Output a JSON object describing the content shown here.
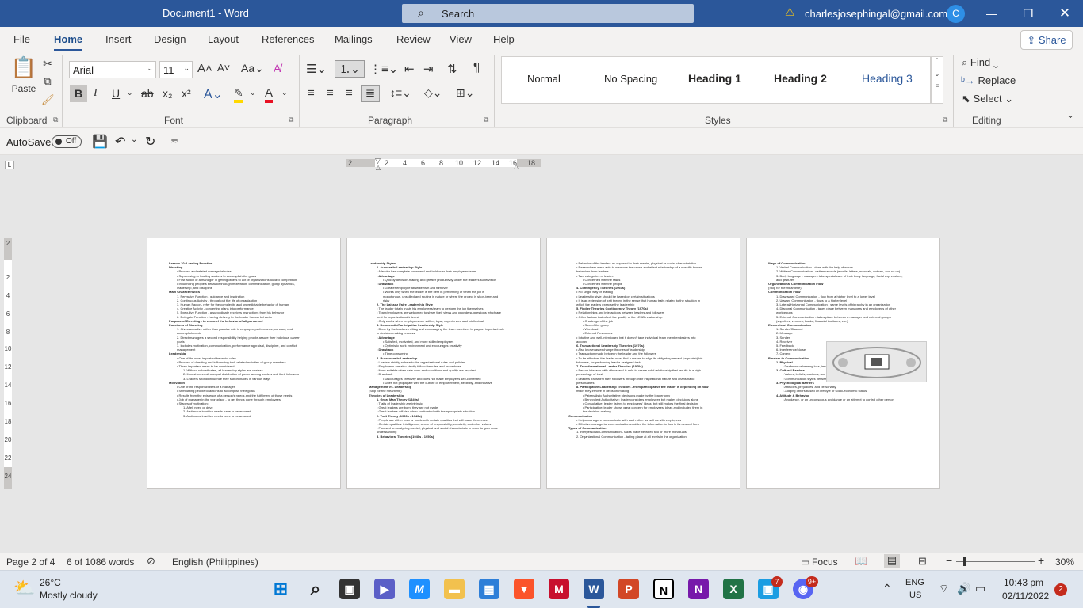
{
  "titlebar": {
    "doc_title": "Document1  -  Word",
    "search_label": "Search",
    "account_email": "charlesjosephingal@gmail.com",
    "avatar_initial": "C"
  },
  "menu": {
    "tabs": [
      "File",
      "Home",
      "Insert",
      "Design",
      "Layout",
      "References",
      "Mailings",
      "Review",
      "View",
      "Help"
    ],
    "active_tab": "Home",
    "share_label": "Share"
  },
  "ribbon": {
    "groups": {
      "clipboard": "Clipboard",
      "font": "Font",
      "paragraph": "Paragraph",
      "styles": "Styles",
      "editing": "Editing"
    },
    "paste_label": "Paste",
    "font_name": "Arial",
    "font_size": "11",
    "styles": [
      "Normal",
      "No Spacing",
      "Heading 1",
      "Heading 2",
      "Heading 3"
    ],
    "find_label": "Find",
    "replace_label": "Replace",
    "select_label": "Select"
  },
  "qat": {
    "autosave_label": "AutoSave",
    "autosave_state": "Off"
  },
  "ruler": {
    "marks": [
      "2",
      "2",
      "4",
      "6",
      "8",
      "10",
      "12",
      "14",
      "16",
      "18"
    ],
    "vmarks": [
      "2",
      "2",
      "4",
      "6",
      "8",
      "10",
      "12",
      "14",
      "16",
      "18",
      "20",
      "22",
      "24"
    ]
  },
  "pages": [
    {
      "lines": [
        {
          "t": "Lesson 10: Leading Function",
          "c": "h"
        },
        {
          "t": "Directing",
          "c": "h"
        },
        {
          "t": "•  Process and related managerial roles",
          "c": "ind"
        },
        {
          "t": "•  Supervising or leading workers to accomplish the goals",
          "c": "ind"
        },
        {
          "t": "•  First action of a manager in getting others to act of organizations toward competition",
          "c": "ind"
        },
        {
          "t": "•  Influencing people's behavior through motivation, communication, group dynamics,",
          "c": "ind"
        },
        {
          "t": "    leadership, and discipline",
          "c": "ind"
        },
        {
          "t": "Main Characteristics",
          "c": "h"
        },
        {
          "t": "1.  Pervasive Function - guidance and inspiration",
          "c": "ind"
        },
        {
          "t": "2.  Continuous Activity - throughout the life of organization",
          "c": "ind"
        },
        {
          "t": "3.  Human Factor - refer for the complexity and unpredictable behavior of human",
          "c": "ind"
        },
        {
          "t": "4.  Creative Activity - converting plans into performance",
          "c": "ind"
        },
        {
          "t": "5.  Executive Function - a subordinate receives instructions from his behavior",
          "c": "ind"
        },
        {
          "t": "6.  Delegate Function - having delivery to the leader human behavior",
          "c": "ind"
        },
        {
          "t": "Purpose of Directing - to channel the behavior of all personnel",
          "c": "h"
        },
        {
          "t": "Functions of Directing",
          "c": "h"
        },
        {
          "t": "1.  Gives an active rather than passive role in employee performance, conduct, and",
          "c": "ind"
        },
        {
          "t": "    accomplishments",
          "c": "ind"
        },
        {
          "t": "2.  Direct managers a second responsibility helping people assure their individual career",
          "c": "ind"
        },
        {
          "t": "    goals",
          "c": "ind"
        },
        {
          "t": "3.  Includes motivation, communication, performance appraisal, discipline, and conflict",
          "c": "ind"
        },
        {
          "t": "    management",
          "c": "ind"
        },
        {
          "t": "Leadership",
          "c": "h"
        },
        {
          "t": "•  One of the most important behavior roles",
          "c": "ind"
        },
        {
          "t": "•  Process of directing and influencing task-related activities of group members",
          "c": "ind"
        },
        {
          "t": "•  Three important areas to be considered:",
          "c": "ind"
        },
        {
          "t": "1.  Without subordinates, all leadership styles are useless",
          "c": "ind2"
        },
        {
          "t": "2.  It must cover all unequal distribution of power among leaders and their followers",
          "c": "ind2"
        },
        {
          "t": "3.  Leaders should influence their subordinates in various ways",
          "c": "ind2"
        },
        {
          "t": "Motivation",
          "c": "h"
        },
        {
          "t": "•  One of the responsibilities of a manager",
          "c": "ind"
        },
        {
          "t": "•  Stimulating people to actions to accomplish their goals",
          "c": "ind"
        },
        {
          "t": "•  Results from the existence of a person's needs and the fulfillment of those needs",
          "c": "ind"
        },
        {
          "t": "•  Job of manager in the workplace - to get things done through employees",
          "c": "ind"
        },
        {
          "t": "•  Stages of motivation:",
          "c": "ind"
        },
        {
          "t": "1.  A felt need or drive",
          "c": "ind2"
        },
        {
          "t": "2.  A stimulus in which needs have to be aroused",
          "c": "ind2"
        },
        {
          "t": "3.  A stimulus in which needs have to be aroused",
          "c": "ind2"
        }
      ]
    },
    {
      "lines": [
        {
          "t": "Leadership Styles",
          "c": "h"
        },
        {
          "t": "1.  Autocratic Leadership Style",
          "c": "h ind"
        },
        {
          "t": "•  A leader has complete command and hold over their employees/team",
          "c": "ind"
        },
        {
          "t": "•  Advantage",
          "c": "h ind"
        },
        {
          "t": "•  Quickly decision-making and greater productivity under the leader's supervision",
          "c": "ind2"
        },
        {
          "t": "•  Drawback",
          "c": "h ind"
        },
        {
          "t": "•  Greater employee absenteeism and turnover",
          "c": "ind2"
        },
        {
          "t": "•  Works only when the leader is the best in performing or when the job is",
          "c": "ind2"
        },
        {
          "t": "   monotonous, unskilled and routine in nature or where the project is short-term and",
          "c": "ind2"
        },
        {
          "t": "   risky",
          "c": "ind2"
        },
        {
          "t": "2.  The Laissez Faire Leadership Style",
          "c": "h ind"
        },
        {
          "t": "•  The leader totally trusts his employees/team to perform the job themselves",
          "c": "ind"
        },
        {
          "t": "•  Team/employees are welcomed to share their views and provide suggestions which are",
          "c": "ind"
        },
        {
          "t": "   best for organizational interest",
          "c": "ind"
        },
        {
          "t": "•  Only works when employees are skilled, loyal, experienced and intellectual",
          "c": "ind"
        },
        {
          "t": "3.  Democratic/Participative Leadership Style",
          "c": "h ind"
        },
        {
          "t": "•  Done by the leaders inviting and encouraging the team members to play an important role",
          "c": "ind"
        },
        {
          "t": "   in decision-making process",
          "c": "ind"
        },
        {
          "t": "•  Advantage",
          "c": "h ind"
        },
        {
          "t": "•  Satisfied, motivated, and more skilled employees",
          "c": "ind2"
        },
        {
          "t": "•  Optimistic work environment and encourages creativity",
          "c": "ind2"
        },
        {
          "t": "•  Drawback",
          "c": "h ind"
        },
        {
          "t": "•  Time-consuming",
          "c": "ind2"
        },
        {
          "t": "4.  Bureaucratic Leadership",
          "c": "h ind"
        },
        {
          "t": "•  Leaders strictly adhere to the organizational rules and policies",
          "c": "ind"
        },
        {
          "t": "•  Employees are also strictly follow the rules and procedures",
          "c": "ind"
        },
        {
          "t": "•  More suitable when safe work and conditions and quality are required",
          "c": "ind"
        },
        {
          "t": "•  Drawback",
          "c": "ind"
        },
        {
          "t": "•  Discourages creativity and does not make employees self-contented",
          "c": "ind2"
        },
        {
          "t": "•  Does not propagate well the culture of empowerment, flexibility, and initiative",
          "c": "ind2"
        },
        {
          "t": "Management Vs. Leadership",
          "c": "h"
        },
        {
          "t": "(Skip for the meantime)",
          "c": ""
        },
        {
          "t": "Theories of Leadership",
          "c": "h"
        },
        {
          "t": "1.  Great Man Theory (1840s)",
          "c": "h ind"
        },
        {
          "t": "•  Traits of leadership are intrinsic",
          "c": "ind"
        },
        {
          "t": "•  Great leaders are born, they are not made",
          "c": "ind"
        },
        {
          "t": "•  Great leaders will rise when confronted with the appropriate situation",
          "c": "ind"
        },
        {
          "t": "2.  Trait Theory (1930s - 1940s)",
          "c": "h ind"
        },
        {
          "t": "•  People are either born or made with certain qualities that will make them excel",
          "c": "ind"
        },
        {
          "t": "•  Certain qualities: intelligence, sense of responsibility, creativity, and other values",
          "c": "ind"
        },
        {
          "t": "•  Focused on analyzing mental, physical and social characteristic in order to gain more",
          "c": "ind"
        },
        {
          "t": "   understanding",
          "c": "ind"
        },
        {
          "t": "3.  Behavioral Theories (1940s - 1950s)",
          "c": "h ind"
        }
      ]
    },
    {
      "lines": [
        {
          "t": "•  Behavior of the leaders as opposed to their mental, physical or social characteristics",
          "c": "ind"
        },
        {
          "t": "•  Researchers were able to measure the cause and effect relationship of a specific human",
          "c": "ind"
        },
        {
          "t": "   behaviors from leaders",
          "c": "ind"
        },
        {
          "t": "•  Two categories of leader:",
          "c": "ind"
        },
        {
          "t": "•  Concerned with the tasks",
          "c": "ind2"
        },
        {
          "t": "•  Concerned with the people",
          "c": "ind2"
        },
        {
          "t": "4.  Contingency Theories (1960s)",
          "c": "h ind"
        },
        {
          "t": "•  No single way of leading",
          "c": "ind"
        },
        {
          "t": "•  Leadership style should be based on certain situations",
          "c": "ind"
        },
        {
          "t": "•  It is an extension of trait theory, in the sense that human traits related to the situation in",
          "c": "ind"
        },
        {
          "t": "   which the leaders exercise the leadership",
          "c": "ind"
        },
        {
          "t": "5.  Fiedler Theories Contingency Theory (1970s)",
          "c": "h ind"
        },
        {
          "t": "•  Relationships and interactions between leaders and followers",
          "c": "ind"
        },
        {
          "t": "•  Other factors that affect the quality of the LEAD relationship:",
          "c": "ind"
        },
        {
          "t": "•  Challenge of the job",
          "c": "ind2"
        },
        {
          "t": "•  Size of the group",
          "c": "ind2"
        },
        {
          "t": "•  Workload",
          "c": "ind2"
        },
        {
          "t": "•  External Resources",
          "c": "ind2"
        },
        {
          "t": "•  Intuitive and well-intentioned but it doesn't take individual team member desires into",
          "c": "ind"
        },
        {
          "t": "   account",
          "c": "ind"
        },
        {
          "t": "6.  Transactional Leadership Theories (1970s)",
          "c": "h ind"
        },
        {
          "t": "•  Also known as exchange theories of leadership",
          "c": "ind"
        },
        {
          "t": "•  Transaction made between the leader and the followers",
          "c": "ind"
        },
        {
          "t": "•  To be effective, the leader must find a means to align its obligatory reward (or punish) his",
          "c": "ind"
        },
        {
          "t": "   followers, for performing leader-assigned task",
          "c": "ind"
        },
        {
          "t": "7.  Transformational Leader Theories (1970s)",
          "c": "h ind"
        },
        {
          "t": "•  Person interacts with others and is able to create solid relationship that results in a high",
          "c": "ind"
        },
        {
          "t": "   percentage of trust",
          "c": "ind"
        },
        {
          "t": "•  Leaders transform their followers through their inspirational nature and charismatic",
          "c": "ind"
        },
        {
          "t": "   personalities",
          "c": "ind"
        },
        {
          "t": "8.  Participative Leadership Theories - from participative the leader is depending on how",
          "c": "h ind"
        },
        {
          "t": "   much they involve in decision-making",
          "c": "ind"
        },
        {
          "t": "•  Paternalistic Authoritative: decisions made by the leader only",
          "c": "ind2"
        },
        {
          "t": "•  Benevolent Authoritative: leader considers employees but makes decisions alone",
          "c": "ind2"
        },
        {
          "t": "•  Consultative: leader listens to employees' ideas, but still makes the final decision",
          "c": "ind2"
        },
        {
          "t": "•  Participative: leader shows great concern for employees' ideas and included them in",
          "c": "ind2"
        },
        {
          "t": "   the decision-making",
          "c": "ind2"
        },
        {
          "t": "Communication",
          "c": "h"
        },
        {
          "t": "•  Helps managers communicate with each other as well as with employees",
          "c": "ind"
        },
        {
          "t": "•  Effective managerial communication enables the information to flow in its desired form",
          "c": "ind"
        },
        {
          "t": "Types of Communication",
          "c": "h"
        },
        {
          "t": "1.  Interpersonal Communication - takes place between two or more individuals",
          "c": "ind"
        },
        {
          "t": "2.  Organizational Communication - taking place at all levels in the organization",
          "c": "ind"
        }
      ]
    },
    {
      "lines": [
        {
          "t": "Ways of Communication",
          "c": "h"
        },
        {
          "t": "1.  Verbal Communication - done with the help of words",
          "c": "ind"
        },
        {
          "t": "2.  Written Communication - written records (emails, letters, manuals, notices, and so on)",
          "c": "ind"
        },
        {
          "t": "3.  Body language - managers take special care of their body language, facial expressions,",
          "c": "ind"
        },
        {
          "t": "    and gestures",
          "c": "ind"
        },
        {
          "t": "Organizational Communication Flow",
          "c": "h"
        },
        {
          "t": "(Skip for the meantime)",
          "c": ""
        },
        {
          "t": "Communication Flow",
          "c": "h"
        },
        {
          "t": "1.  Downward Communication - flow from a higher level to a lower level",
          "c": "ind"
        },
        {
          "t": "2.  Upward Communication - flows to a higher level",
          "c": "ind"
        },
        {
          "t": "3.  Lateral/Horizontal Communication - same levels of hierarchy in an organization",
          "c": "ind"
        },
        {
          "t": "4.  Diagonal Communication - takes place between managers and employees of other",
          "c": "ind"
        },
        {
          "t": "    workgroups",
          "c": "ind"
        },
        {
          "t": "5.  External Communication - takes place between a manager and external groups",
          "c": "ind"
        },
        {
          "t": "    (suppliers, vendors, banks, financial institutes, etc.)",
          "c": "ind"
        },
        {
          "t": "Elements of Communication",
          "c": "h"
        },
        {
          "t": "1.  Sender/Channel",
          "c": "ind"
        },
        {
          "t": "2.  Message",
          "c": "ind"
        },
        {
          "t": "3.  Sender",
          "c": "ind"
        },
        {
          "t": "4.  Receiver",
          "c": "ind"
        },
        {
          "t": "5.  Feedback",
          "c": "ind"
        },
        {
          "t": "6.  Interference/Noise",
          "c": "ind"
        },
        {
          "t": "7.  Context",
          "c": "ind"
        },
        {
          "t": "Barriers to Communication",
          "c": "h"
        },
        {
          "t": "1.  Physical",
          "c": "h ind"
        },
        {
          "t": "•  Deafness or hearing loss, impaired vision, or speech disabilities",
          "c": "ind2"
        },
        {
          "t": "2.  Cultural Barriers",
          "c": "h ind"
        },
        {
          "t": "•  Values, beliefs, customs, and attitudes shared",
          "c": "ind2"
        },
        {
          "t": "•  Communication styles between culture",
          "c": "ind2"
        },
        {
          "t": "3.  Psychological Barriers",
          "c": "h ind"
        },
        {
          "t": "•  Attitudes, prejudices, and personality",
          "c": "ind2"
        },
        {
          "t": "•  Judging others based on lifestyle or socio-economic status",
          "c": "ind2"
        },
        {
          "t": "4.  Attitude & Behavior",
          "c": "h ind"
        },
        {
          "t": "•  Avoidance, or an unconscious avoidance or an attempt to control other person",
          "c": "ind2"
        }
      ]
    }
  ],
  "status": {
    "page": "Page 2 of 4",
    "words": "6 of 1086 words",
    "language": "English (Philippines)",
    "focus": "Focus",
    "zoom": "30%"
  },
  "taskbar": {
    "weather_temp": "26°C",
    "weather_desc": "Mostly cloudy",
    "lang_top": "ENG",
    "lang_bottom": "US",
    "time": "10:43 pm",
    "date": "02/11/2022",
    "teams_badge": "7",
    "discord_badge": "9+",
    "notif_badge": "2"
  }
}
